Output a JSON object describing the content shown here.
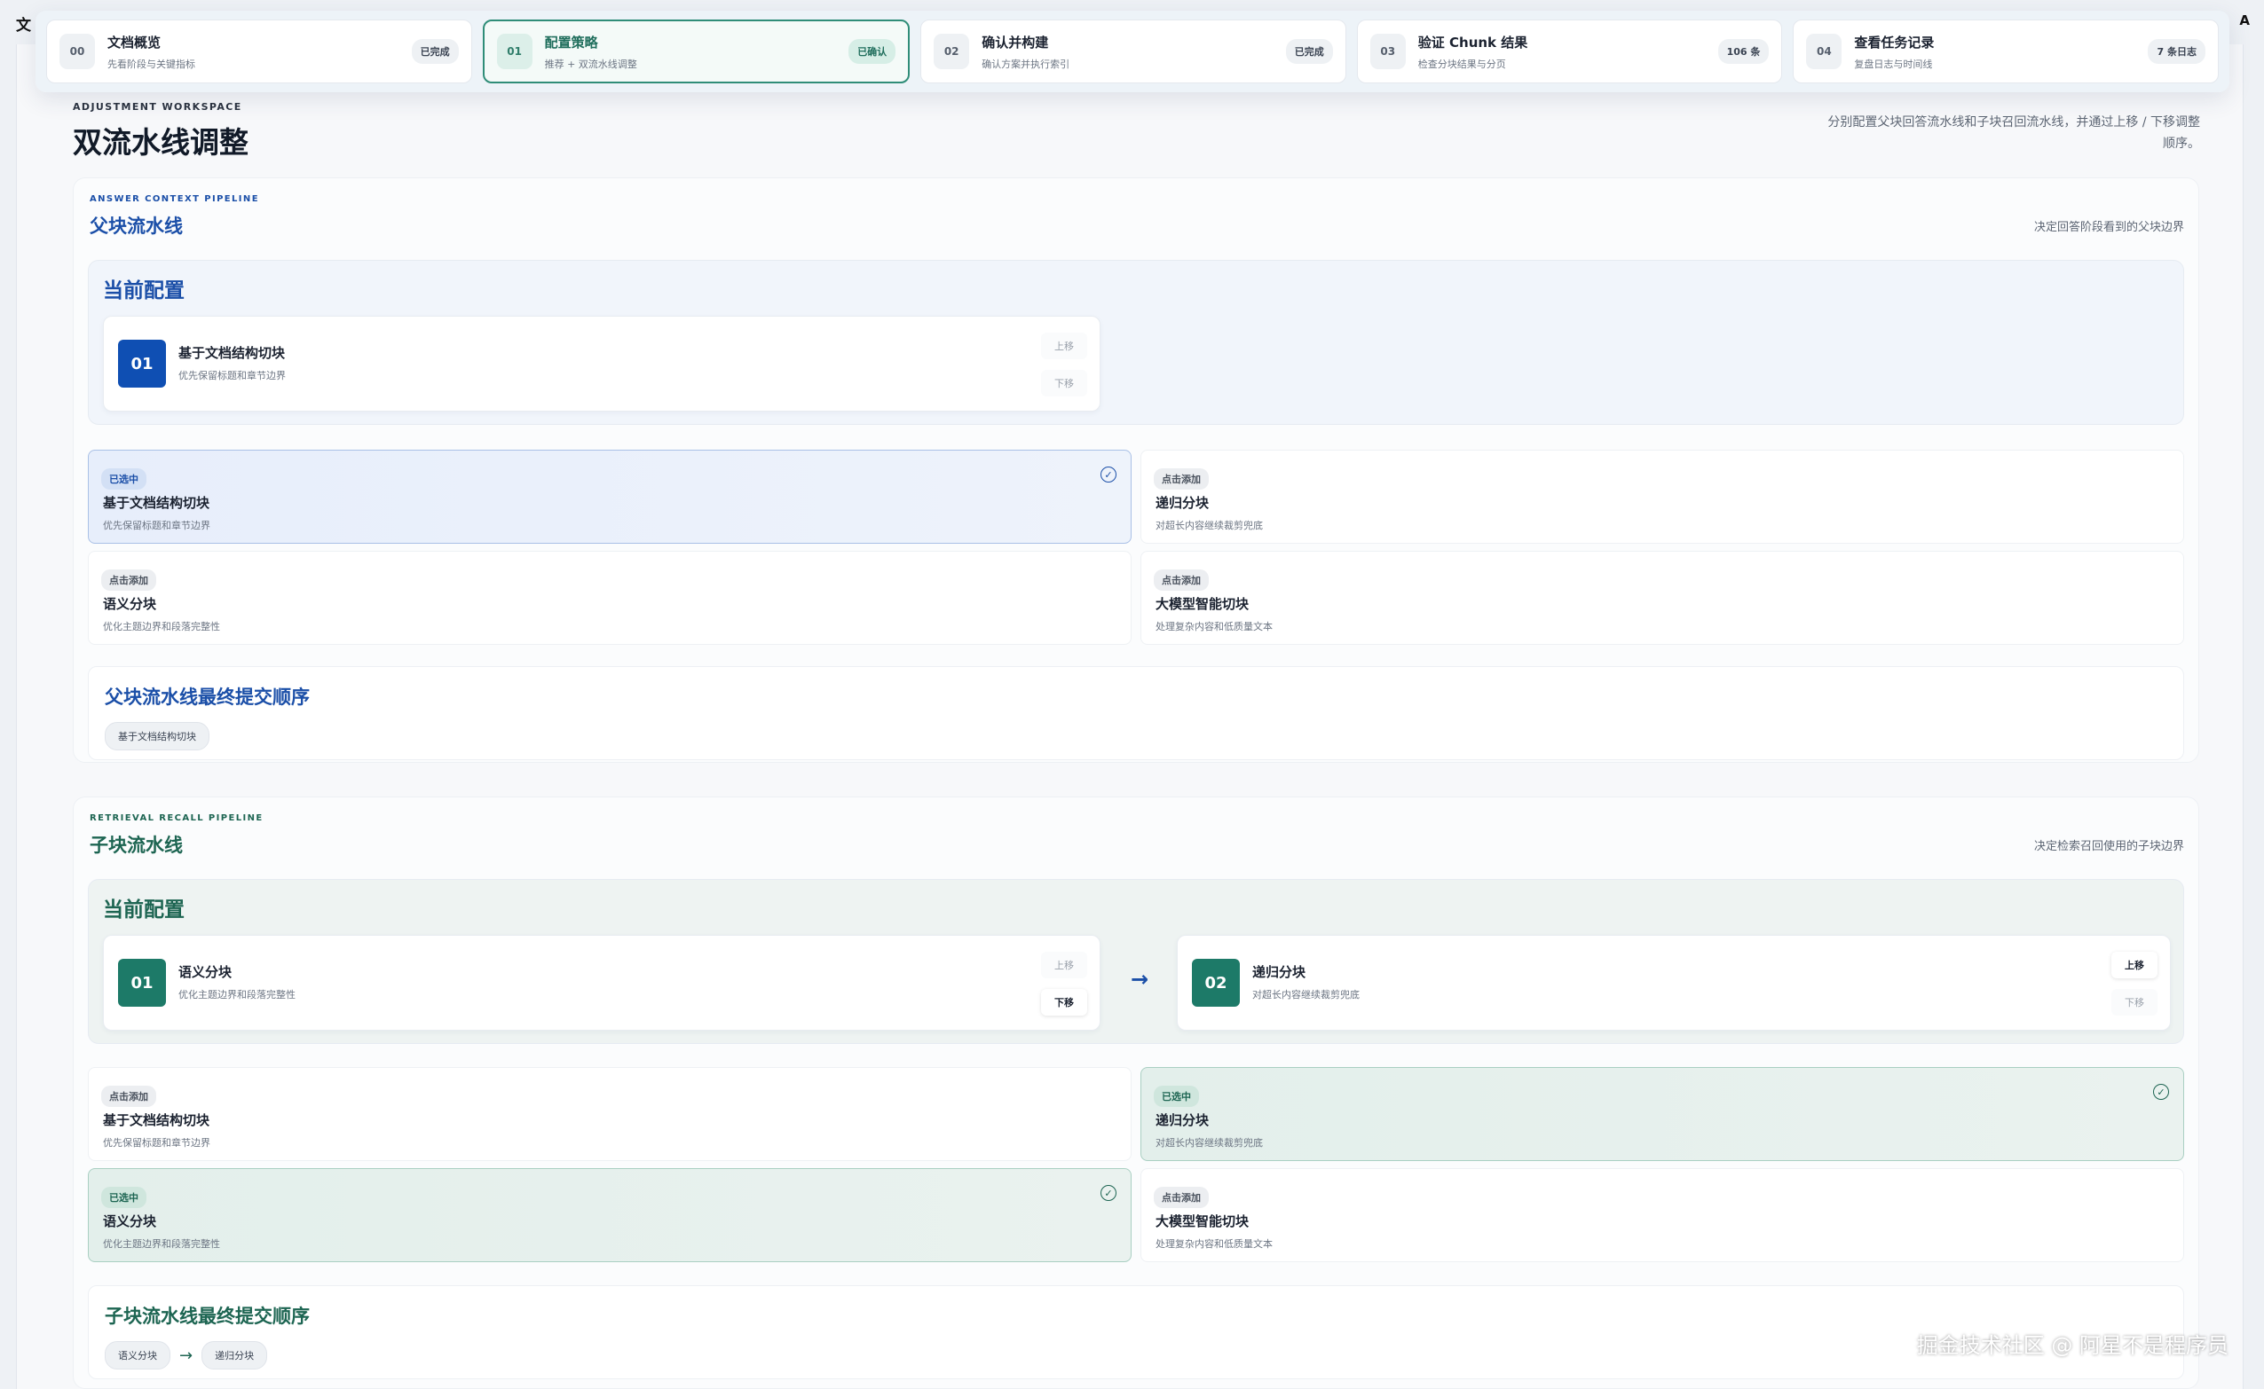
{
  "app": {
    "title_fragment": "文",
    "right_fragment": "A"
  },
  "steps": [
    {
      "num": "00",
      "title": "文档概览",
      "sub": "先看阶段与关键指标",
      "badge": "已完成",
      "active": false
    },
    {
      "num": "01",
      "title": "配置策略",
      "sub": "推荐 + 双流水线调整",
      "badge": "已确认",
      "active": true
    },
    {
      "num": "02",
      "title": "确认并构建",
      "sub": "确认方案并执行索引",
      "badge": "已完成",
      "active": false
    },
    {
      "num": "03",
      "title": "验证 Chunk 结果",
      "sub": "检查分块结果与分页",
      "badge": "106 条",
      "active": false
    },
    {
      "num": "04",
      "title": "查看任务记录",
      "sub": "复盘日志与时间线",
      "badge": "7 条日志",
      "active": false
    }
  ],
  "workspace": {
    "eyebrow": "ADJUSTMENT WORKSPACE",
    "title": "双流水线调整",
    "desc": "分别配置父块回答流水线和子块召回流水线，并通过上移 / 下移调整顺序。"
  },
  "parent": {
    "eyebrow": "ANSWER CONTEXT PIPELINE",
    "title": "父块流水线",
    "note": "决定回答阶段看到的父块边界",
    "current_title": "当前配置",
    "configs": [
      {
        "num": "01",
        "title": "基于文档结构切块",
        "sub": "优先保留标题和章节边界",
        "up": "上移",
        "down": "下移"
      }
    ],
    "options": [
      {
        "tag": "已选中",
        "title": "基于文档结构切块",
        "sub": "优先保留标题和章节边界",
        "check": "✓"
      },
      {
        "tag": "点击添加",
        "title": "递归分块",
        "sub": "对超长内容继续裁剪兜底"
      },
      {
        "tag": "点击添加",
        "title": "语义分块",
        "sub": "优化主题边界和段落完整性"
      },
      {
        "tag": "点击添加",
        "title": "大模型智能切块",
        "sub": "处理复杂内容和低质量文本"
      }
    ],
    "final_title": "父块流水线最终提交顺序",
    "final_chips": [
      "基于文档结构切块"
    ]
  },
  "child": {
    "eyebrow": "RETRIEVAL RECALL PIPELINE",
    "title": "子块流水线",
    "note": "决定检索召回使用的子块边界",
    "current_title": "当前配置",
    "configs": [
      {
        "num": "01",
        "title": "语义分块",
        "sub": "优化主题边界和段落完整性",
        "up": "上移",
        "down": "下移"
      },
      {
        "num": "02",
        "title": "递归分块",
        "sub": "对超长内容继续裁剪兜底",
        "up": "上移",
        "down": "下移"
      }
    ],
    "arrow": "→",
    "options": [
      {
        "tag": "点击添加",
        "title": "基于文档结构切块",
        "sub": "优先保留标题和章节边界"
      },
      {
        "tag": "已选中",
        "title": "递归分块",
        "sub": "对超长内容继续裁剪兜底",
        "check": "✓"
      },
      {
        "tag": "已选中",
        "title": "语义分块",
        "sub": "优化主题边界和段落完整性",
        "check": "✓"
      },
      {
        "tag": "点击添加",
        "title": "大模型智能切块",
        "sub": "处理复杂内容和低质量文本"
      }
    ],
    "final_title": "子块流水线最终提交顺序",
    "final_chips": [
      "语义分块",
      "递归分块"
    ],
    "final_arrow": "→"
  },
  "watermark": "掘金技术社区 @ 阿星不是程序员"
}
